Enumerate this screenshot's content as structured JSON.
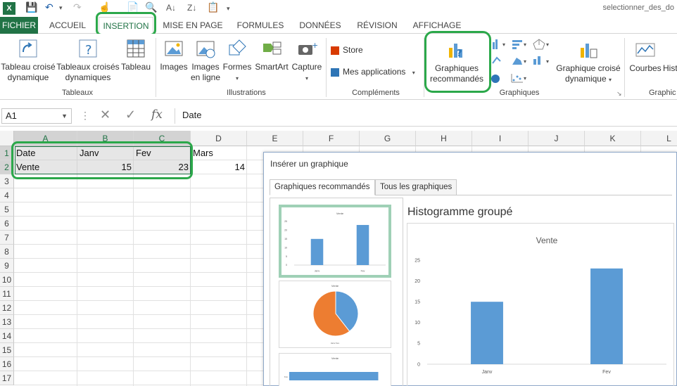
{
  "window": {
    "title": "selectionner_des_do"
  },
  "qat": {
    "app_icon": "X"
  },
  "tabs": {
    "file": "FICHIER",
    "items": [
      "ACCUEIL",
      "INSERTION",
      "MISE EN PAGE",
      "FORMULES",
      "DONNÉES",
      "RÉVISION",
      "AFFICHAGE"
    ],
    "active": "INSERTION"
  },
  "ribbon": {
    "tableaux": {
      "label": "Tableaux",
      "pivot_l1": "Tableau croisé",
      "pivot_l2": "dynamique",
      "rec_pivot_l1": "Tableaux croisés",
      "rec_pivot_l2": "dynamiques",
      "table": "Tableau"
    },
    "illustrations": {
      "label": "Illustrations",
      "images": "Images",
      "online_l1": "Images",
      "online_l2": "en ligne",
      "shapes": "Formes",
      "smartart": "SmartArt",
      "capture": "Capture"
    },
    "complements": {
      "label": "Compléments",
      "store": "Store",
      "myapps": "Mes applications"
    },
    "graphiques": {
      "label": "Graphiques",
      "recommended_l1": "Graphiques",
      "recommended_l2": "recommandés",
      "pivot_chart_l1": "Graphique croisé",
      "pivot_chart_l2": "dynamique"
    },
    "sparklines": {
      "label": "Graphic",
      "lines": "Courbes",
      "hist": "Hist"
    }
  },
  "formula_bar": {
    "name_box": "A1",
    "fx": "fx",
    "value": "Date"
  },
  "grid": {
    "columns": [
      "A",
      "B",
      "C",
      "D",
      "E",
      "F",
      "G",
      "H",
      "I",
      "J",
      "K",
      "L"
    ],
    "rows": [
      "1",
      "2",
      "3",
      "4",
      "5",
      "6",
      "7",
      "8",
      "9",
      "10",
      "11",
      "12",
      "13",
      "14",
      "15",
      "16",
      "17"
    ],
    "cells": {
      "A1": "Date",
      "B1": "Janv",
      "C1": "Fev",
      "D1": "Mars",
      "A2": "Vente",
      "B2": "15",
      "C2": "23",
      "D2": "14"
    }
  },
  "dialog": {
    "title": "Insérer un graphique",
    "tab_recommended": "Graphiques recommandés",
    "tab_all": "Tous les graphiques",
    "preview_title": "Histogramme groupé"
  },
  "colors": {
    "accent": "#217346",
    "highlight": "#2ba84a",
    "bar": "#5b9bd5",
    "pie_orange": "#ed7d31"
  },
  "chart_data": {
    "type": "bar",
    "title": "Vente",
    "categories": [
      "Janv",
      "Fev"
    ],
    "values": [
      15,
      23
    ],
    "ylim": [
      0,
      25
    ],
    "yticks": [
      0,
      5,
      10,
      15,
      20,
      25
    ],
    "grid": false,
    "legend": "none"
  }
}
